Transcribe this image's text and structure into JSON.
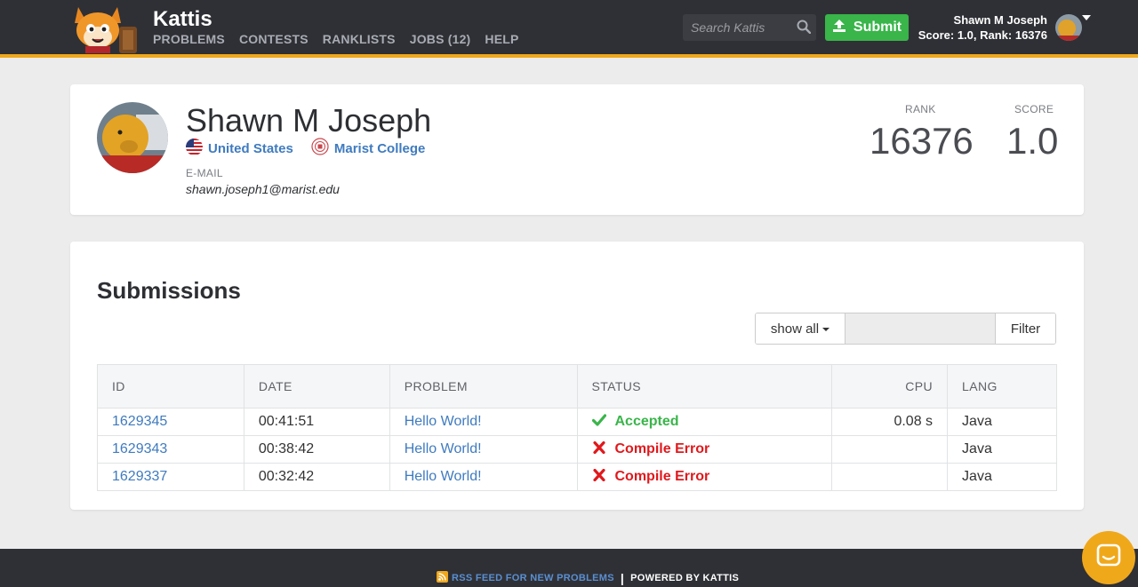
{
  "header": {
    "brand": "Kattis",
    "nav": [
      "PROBLEMS",
      "CONTESTS",
      "RANKLISTS",
      "JOBS (12)",
      "HELP"
    ],
    "search_placeholder": "Search Kattis",
    "submit_label": "Submit",
    "user_name": "Shawn M Joseph",
    "user_stats": "Score: 1.0, Rank: 16376"
  },
  "profile": {
    "name": "Shawn M Joseph",
    "country": "United States",
    "school": "Marist College",
    "email_label": "E-MAIL",
    "email": "shawn.joseph1@marist.edu",
    "rank_label": "RANK",
    "rank": "16376",
    "score_label": "SCORE",
    "score": "1.0"
  },
  "submissions": {
    "title": "Submissions",
    "filter_show": "show all",
    "filter_button": "Filter",
    "columns": [
      "ID",
      "DATE",
      "PROBLEM",
      "STATUS",
      "CPU",
      "LANG"
    ],
    "rows": [
      {
        "id": "1629345",
        "date": "00:41:51",
        "problem": "Hello World!",
        "status": "Accepted",
        "status_type": "ok",
        "cpu": "0.08 s",
        "lang": "Java"
      },
      {
        "id": "1629343",
        "date": "00:38:42",
        "problem": "Hello World!",
        "status": "Compile Error",
        "status_type": "err",
        "cpu": "",
        "lang": "Java"
      },
      {
        "id": "1629337",
        "date": "00:32:42",
        "problem": "Hello World!",
        "status": "Compile Error",
        "status_type": "err",
        "cpu": "",
        "lang": "Java"
      }
    ]
  },
  "footer": {
    "rss_label": "RSS FEED FOR NEW PROBLEMS",
    "separator": "|",
    "powered": "POWERED BY KATTIS"
  },
  "colors": {
    "header_bg": "#2f3035",
    "accent": "#f0a81b",
    "link": "#3f7bbf",
    "success": "#39b54a",
    "error": "#e0191d"
  }
}
